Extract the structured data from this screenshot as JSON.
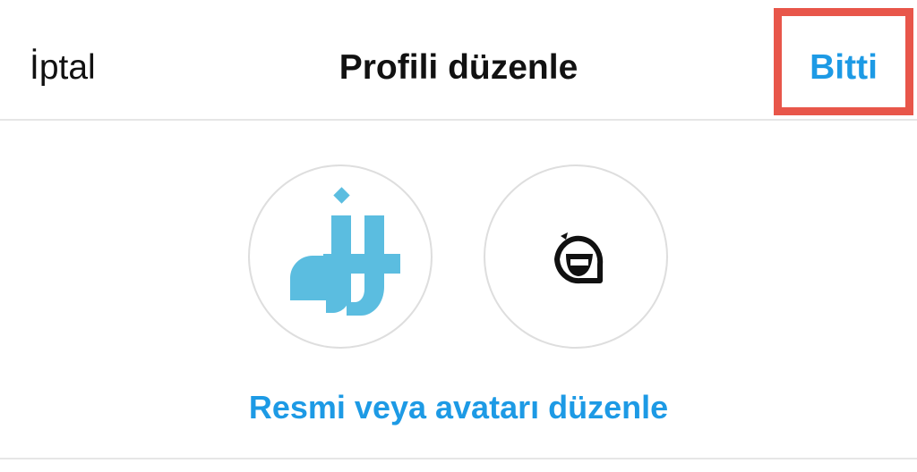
{
  "header": {
    "cancel_label": "İptal",
    "title": "Profili düzenle",
    "done_label": "Bitti"
  },
  "avatars": {
    "profile_picture": "dijital-logo",
    "avatar": "smiling-face-sticker"
  },
  "edit_link": "Resmi veya avatarı düzenle",
  "colors": {
    "accent": "#1d9ae5",
    "logo": "#5bbde0",
    "highlight": "#e8564a",
    "divider": "#e6e6e6"
  }
}
